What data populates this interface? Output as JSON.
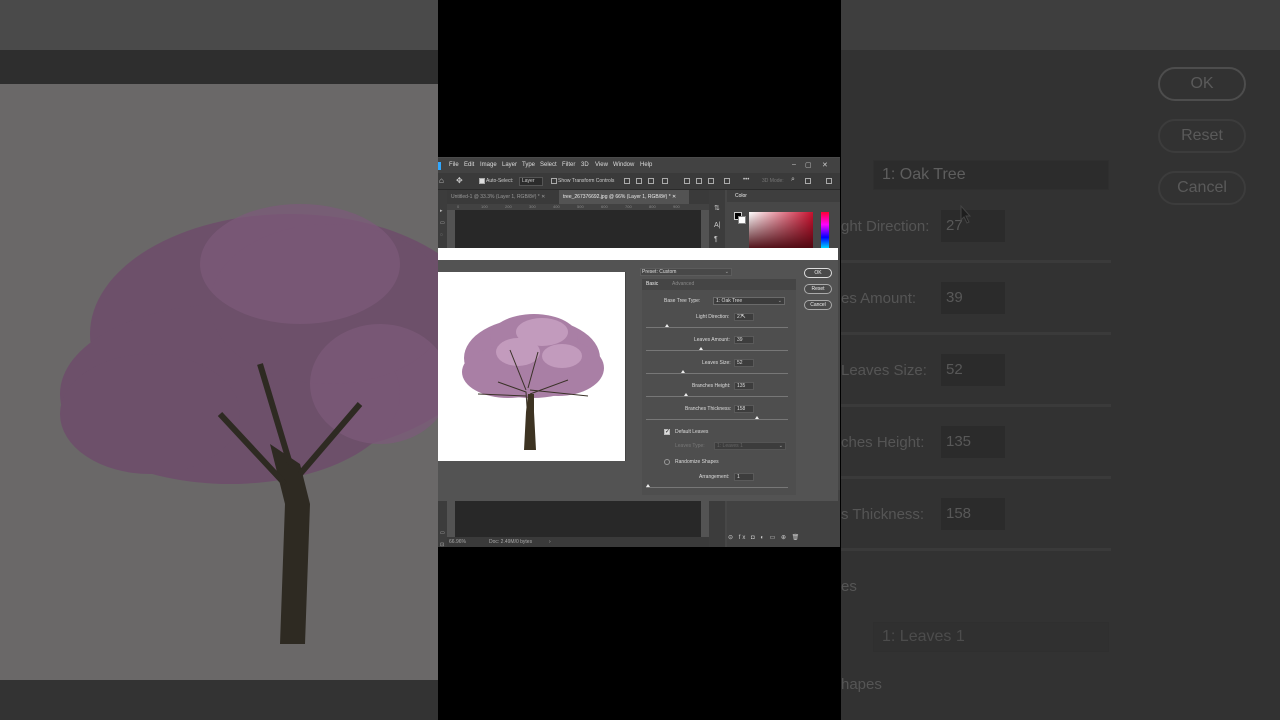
{
  "background_left": {},
  "background_right": {
    "buttons": {
      "ok": "OK",
      "reset": "Reset",
      "cancel": "Cancel"
    },
    "tree_type": "1: Oak Tree",
    "fields": [
      {
        "label": "ght Direction:",
        "value": "27"
      },
      {
        "label": "es Amount:",
        "value": "39"
      },
      {
        "label": "Leaves Size:",
        "value": "52"
      },
      {
        "label": "ches Height:",
        "value": "135"
      },
      {
        "label": "s Thickness:",
        "value": "158"
      }
    ],
    "leaves_type": "1: Leaves 1",
    "section_es": "es",
    "section_shapes": "hapes"
  },
  "menubar": {
    "items": [
      "File",
      "Edit",
      "Image",
      "Layer",
      "Type",
      "Select",
      "Filter",
      "3D",
      "View",
      "Window",
      "Help"
    ],
    "window_controls": [
      "–",
      "▢",
      "✕"
    ]
  },
  "options_bar": {
    "auto_select_label": "Auto-Select:",
    "auto_select_value": "Layer",
    "show_transform": "Show Transform Controls",
    "more": "•••",
    "mode_3d": "3D Mode:"
  },
  "doc_tabs": [
    {
      "label": "Untitled-1 @ 33.3% (Layer 1, RGB/8#) * ✕",
      "active": false
    },
    {
      "label": "tree_267376692.jpg @ 66% (Layer 1, RGB/8#) * ✕",
      "active": true
    }
  ],
  "ruler_ticks": [
    "0",
    "100",
    "200",
    "300",
    "400",
    "500",
    "600",
    "700",
    "800",
    "900"
  ],
  "right_panel": {
    "color_tab": "Color",
    "strip_icons": [
      "⇅",
      "A|",
      "¶"
    ]
  },
  "statusbar": {
    "zoom": "66.96%",
    "doc": "Doc: 2.49M/0 bytes",
    "arrow": "›"
  },
  "layer_footer": "⊝ fx ◘ ◐ ▭ ⊕ 🗑",
  "dialog": {
    "preset_label": "Preset: Custom",
    "tabs": {
      "basic": "Basic",
      "advanced": "Advanced"
    },
    "buttons": {
      "ok": "OK",
      "reset": "Reset",
      "cancel": "Cancel"
    },
    "base_tree_type_label": "Base Tree Type:",
    "base_tree_type_value": "1: Oak Tree",
    "fields": [
      {
        "label": "Light Direction:",
        "value": "27",
        "slider_fraction": 0.15
      },
      {
        "label": "Leaves Amount:",
        "value": "39",
        "slider_fraction": 0.39
      },
      {
        "label": "Leaves Size:",
        "value": "52",
        "slider_fraction": 0.26
      },
      {
        "label": "Branches Height:",
        "value": "135",
        "slider_fraction": 0.28
      },
      {
        "label": "Branches Thickness:",
        "value": "158",
        "slider_fraction": 0.78
      }
    ],
    "default_leaves_label": "Default Leaves",
    "default_leaves_checked": true,
    "leaves_type_label": "Leaves Type:",
    "leaves_type_value": "1: Leaves 1",
    "randomize_label": "Randomize Shapes",
    "arrangement_label": "Arrangement:",
    "arrangement_value": "1"
  },
  "colors": {
    "accent": "#31a8ff",
    "ps_bg": "#535353",
    "blossom": "#b78bb0"
  }
}
